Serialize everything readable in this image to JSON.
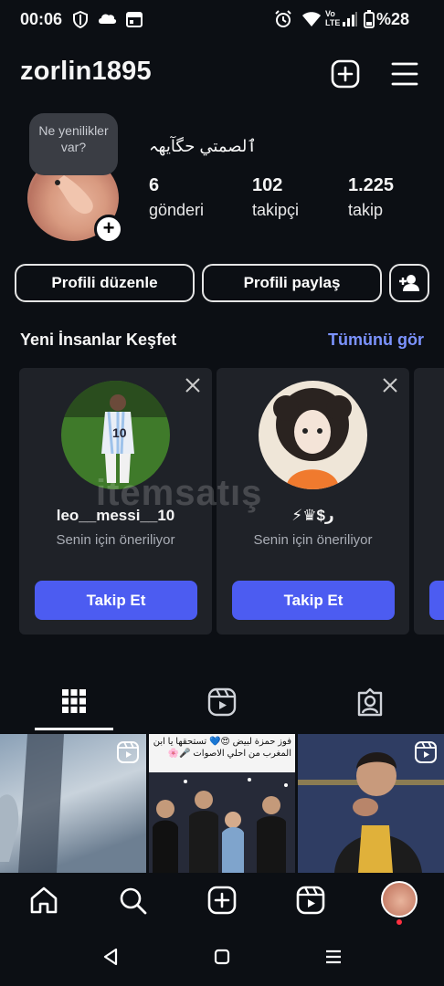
{
  "status_bar": {
    "time": "00:06",
    "battery": "%28",
    "icons": [
      "shield-icon",
      "cloud-icon",
      "calendar-icon",
      "alarm-icon",
      "wifi-icon",
      "volte-icon",
      "signal-icon",
      "battery-icon"
    ]
  },
  "header": {
    "username": "zorlin1895",
    "icons": [
      "create-post-icon",
      "menu-icon"
    ]
  },
  "profile": {
    "note_text": "Ne yenilikler var?",
    "bio": "ٱلصمتي حگآيهہ",
    "stats": [
      {
        "value": "6",
        "label": "gönderi"
      },
      {
        "value": "102",
        "label": "takipçi"
      },
      {
        "value": "1.225",
        "label": "takip"
      }
    ]
  },
  "actions": {
    "edit_profile": "Profili düzenle",
    "share_profile": "Profili paylaş"
  },
  "discover": {
    "title": "Yeni İnsanlar Keşfet",
    "see_all": "Tümünü gör",
    "cards": [
      {
        "name": "leo__messi__10",
        "subtitle": "Senin için öneriliyor",
        "button": "Takip Et"
      },
      {
        "name": "⚡♛$ر",
        "subtitle": "Senin için öneriliyor",
        "button": "Takip Et"
      }
    ]
  },
  "watermark": "itemsatış",
  "grid": {
    "tiles": [
      {
        "caption": ""
      },
      {
        "caption": "فوز حمزة لبيض 😍💙 تستحقها يا ابن المغرب من احلي الاصوات 🎤🌸"
      },
      {
        "caption": ""
      }
    ]
  },
  "colors": {
    "background": "#0c0f14",
    "accent": "#4c5cf1",
    "link": "#7c93ff",
    "card": "#1f2228"
  }
}
